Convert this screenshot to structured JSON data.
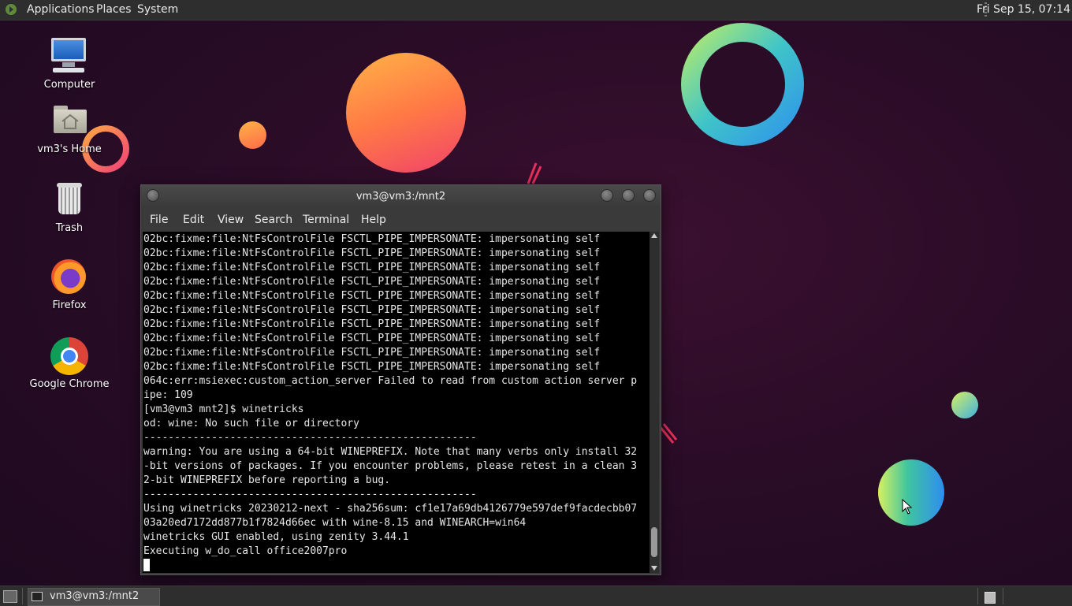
{
  "top_panel": {
    "menus": [
      "Applications",
      "Places",
      "System"
    ],
    "clock": "Fri Sep 15, 07:14"
  },
  "desktop_icons": [
    {
      "label": "Computer",
      "icon": "computer-icon"
    },
    {
      "label": "vm3's Home",
      "icon": "home-folder-icon"
    },
    {
      "label": "Trash",
      "icon": "trash-icon"
    },
    {
      "label": "Firefox",
      "icon": "firefox-icon"
    },
    {
      "label": "Google Chrome",
      "icon": "chrome-icon"
    }
  ],
  "terminal": {
    "title": "vm3@vm3:/mnt2",
    "menu": [
      "File",
      "Edit",
      "View",
      "Search",
      "Terminal",
      "Help"
    ],
    "lines": [
      "02bc:fixme:file:NtFsControlFile FSCTL_PIPE_IMPERSONATE: impersonating self",
      "02bc:fixme:file:NtFsControlFile FSCTL_PIPE_IMPERSONATE: impersonating self",
      "02bc:fixme:file:NtFsControlFile FSCTL_PIPE_IMPERSONATE: impersonating self",
      "02bc:fixme:file:NtFsControlFile FSCTL_PIPE_IMPERSONATE: impersonating self",
      "02bc:fixme:file:NtFsControlFile FSCTL_PIPE_IMPERSONATE: impersonating self",
      "02bc:fixme:file:NtFsControlFile FSCTL_PIPE_IMPERSONATE: impersonating self",
      "02bc:fixme:file:NtFsControlFile FSCTL_PIPE_IMPERSONATE: impersonating self",
      "02bc:fixme:file:NtFsControlFile FSCTL_PIPE_IMPERSONATE: impersonating self",
      "02bc:fixme:file:NtFsControlFile FSCTL_PIPE_IMPERSONATE: impersonating self",
      "02bc:fixme:file:NtFsControlFile FSCTL_PIPE_IMPERSONATE: impersonating self",
      "064c:err:msiexec:custom_action_server Failed to read from custom action server p",
      "ipe: 109",
      "[vm3@vm3 mnt2]$ winetricks",
      "od: wine: No such file or directory",
      "------------------------------------------------------",
      "warning: You are using a 64-bit WINEPREFIX. Note that many verbs only install 32",
      "-bit versions of packages. If you encounter problems, please retest in a clean 3",
      "2-bit WINEPREFIX before reporting a bug.",
      "------------------------------------------------------",
      "Using winetricks 20230212-next - sha256sum: cf1e17a69db4126779e597def9facdecbb07",
      "03a20ed7172dd877b1f7824d66ec with wine-8.15 and WINEARCH=win64",
      "winetricks GUI enabled, using zenity 3.44.1",
      "Executing w_do_call office2007pro"
    ]
  },
  "taskbar": {
    "tasks": [
      {
        "label": "vm3@vm3:/mnt2"
      }
    ]
  }
}
